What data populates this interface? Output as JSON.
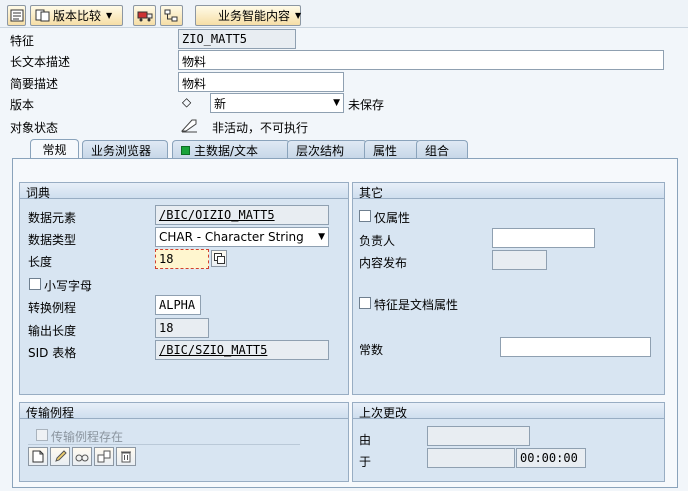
{
  "toolbar": {
    "version_compare_label": "版本比较",
    "business_content_label": "业务智能内容"
  },
  "header": {
    "characteristic_label": "特征",
    "characteristic_value": "ZIO_MATT5",
    "long_desc_label": "长文本描述",
    "long_desc_value": "物料",
    "short_desc_label": "简要描述",
    "short_desc_value": "物料",
    "version_label": "版本",
    "version_value": "新",
    "version_status": "未保存",
    "object_status_label": "对象状态",
    "object_status_value": "非活动，不可执行"
  },
  "tabs": [
    {
      "label": "常规"
    },
    {
      "label": "业务浏览器"
    },
    {
      "label": "主数据/文本"
    },
    {
      "label": "层次结构"
    },
    {
      "label": "属性"
    },
    {
      "label": "组合"
    }
  ],
  "dictionary": {
    "title": "词典",
    "data_element_label": "数据元素",
    "data_element_value": "/BIC/OIZIO_MATT5",
    "data_type_label": "数据类型",
    "data_type_value": "CHAR - Character String",
    "length_label": "长度",
    "length_value": "18",
    "lowercase_label": "小写字母",
    "conv_routine_label": "转换例程",
    "conv_routine_value": "ALPHA",
    "output_length_label": "输出长度",
    "output_length_value": "18",
    "sid_table_label": "SID 表格",
    "sid_table_value": "/BIC/SZIO_MATT5"
  },
  "other": {
    "title": "其它",
    "attr_only_label": "仅属性",
    "person_responsible_label": "负责人",
    "person_responsible_value": "",
    "content_release_label": "内容发布",
    "content_release_value": "",
    "doc_attr_label": "特征是文档属性",
    "constant_label": "常数",
    "constant_value": ""
  },
  "transfer": {
    "title": "传输例程",
    "exists_label": "传输例程存在"
  },
  "last_change": {
    "title": "上次更改",
    "by_label": "由",
    "by_value": "",
    "at_label": "于",
    "date_value": "",
    "time_value": "00:00:00"
  },
  "colors": {
    "panel_bg": "#d8e5f2",
    "button_bg": "#f6dea6",
    "active_dot": "#19a33a"
  }
}
